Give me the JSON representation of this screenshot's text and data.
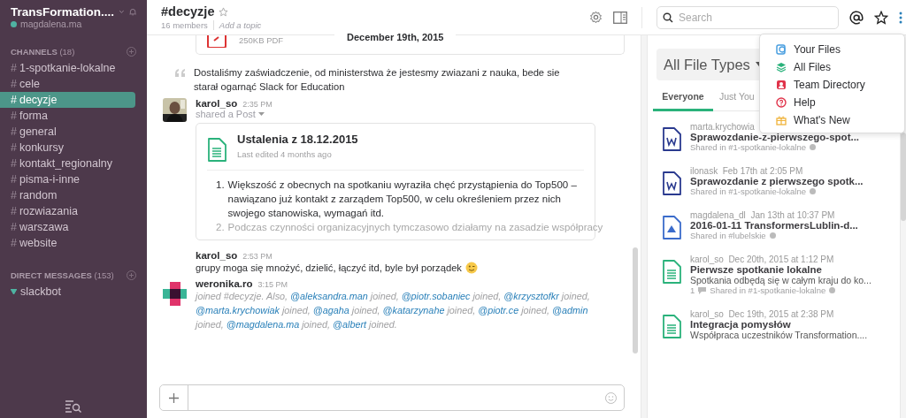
{
  "sidebar": {
    "team": "TransFormation....",
    "user": "magdalena.ma",
    "user_online": true,
    "channels_label": "CHANNELS",
    "channels_count": "(18)",
    "channels": [
      {
        "prefix": "#",
        "name": "1-spotkanie-lokalne",
        "selected": false
      },
      {
        "prefix": "#",
        "name": "cele",
        "selected": false
      },
      {
        "prefix": "#",
        "name": "decyzje",
        "selected": true
      },
      {
        "prefix": "#",
        "name": "forma",
        "selected": false
      },
      {
        "prefix": "#",
        "name": "general",
        "selected": false
      },
      {
        "prefix": "#",
        "name": "konkursy",
        "selected": false
      },
      {
        "prefix": "#",
        "name": "kontakt_regionalny",
        "selected": false
      },
      {
        "prefix": "#",
        "name": "pisma-i-inne",
        "selected": false
      },
      {
        "prefix": "#",
        "name": "random",
        "selected": false
      },
      {
        "prefix": "#",
        "name": "rozwiazania",
        "selected": false
      },
      {
        "prefix": "#",
        "name": "warszawa",
        "selected": false
      },
      {
        "prefix": "#",
        "name": "website",
        "selected": false
      }
    ],
    "dm_label": "DIRECT MESSAGES",
    "dm_count": "(153)",
    "direct_messages": [
      {
        "name": "slackbot",
        "online": true
      }
    ]
  },
  "header": {
    "channel": "#decyzje",
    "members": "16 members",
    "topic": "Add a topic",
    "search_placeholder": "Search"
  },
  "date_divider": "December 19th, 2015",
  "messages": [
    {
      "kind": "file_tail",
      "meta": "250KB PDF"
    },
    {
      "kind": "quote",
      "text": "Dostaliśmy zaświadczenie, od ministerstwa że jestesmy zwiazani z nauka, bede sie starał ogarnąć Slack for Education"
    },
    {
      "kind": "post",
      "author": "karol_so",
      "time": "2:35 PM",
      "action": "shared a Post",
      "title": "Ustalenia z 18.12.2015",
      "edited": "Last edited 4 months ago",
      "items": [
        {
          "marker": "1.",
          "text": "Większość z obecnych na spotkaniu wyraziła chęć przystąpienia do Top500 – nawiązano już kontakt z zarządem Top500, w celu określeniem przez nich swojego stanowiska, wymagań itd."
        },
        {
          "marker": "2.",
          "text": "Podczas czynności organizacyjnych tymczasowo działamy na zasadzie współpracy"
        }
      ]
    },
    {
      "kind": "message",
      "author": "karol_so",
      "time": "2:53 PM",
      "text": "grupy moga się mnożyć, dzielić, łączyć itd, byle był porządek"
    },
    {
      "kind": "join",
      "author": "weronika.ro",
      "time": "3:15 PM",
      "parts": [
        {
          "kind": "text",
          "text": "joined #decyzje. Also, "
        },
        {
          "kind": "mention",
          "text": "@aleksandra.man"
        },
        {
          "kind": "text",
          "text": " joined, "
        },
        {
          "kind": "mention",
          "text": "@piotr.sobaniec"
        },
        {
          "kind": "text",
          "text": " joined, "
        },
        {
          "kind": "mention",
          "text": "@krzysztofkr"
        },
        {
          "kind": "text",
          "text": " joined, "
        },
        {
          "kind": "mention",
          "text": "@marta.krychowiak"
        },
        {
          "kind": "text",
          "text": " joined, "
        },
        {
          "kind": "mention",
          "text": "@agaha"
        },
        {
          "kind": "text",
          "text": " joined, "
        },
        {
          "kind": "mention",
          "text": "@katarzynahe"
        },
        {
          "kind": "text",
          "text": " joined, "
        },
        {
          "kind": "mention",
          "text": "@piotr.ce"
        },
        {
          "kind": "text",
          "text": " joined, "
        },
        {
          "kind": "mention",
          "text": "@admin"
        },
        {
          "kind": "text",
          "text": " joined, "
        },
        {
          "kind": "mention",
          "text": "@magdalena.ma"
        },
        {
          "kind": "text",
          "text": " joined, "
        },
        {
          "kind": "mention",
          "text": "@albert"
        },
        {
          "kind": "text",
          "text": " joined."
        }
      ]
    }
  ],
  "files_panel": {
    "filter": "All File Types",
    "tabs": [
      {
        "label": "Everyone",
        "selected": true
      },
      {
        "label": "Just You",
        "selected": false
      }
    ],
    "files": [
      {
        "kind": "word",
        "author": "marta.krychowia",
        "title": "Sprawozdanie-z-pierwszego-spot...",
        "shared": "Shared in #1-spotkanie-lokalne"
      },
      {
        "kind": "word",
        "author": "ilonask",
        "time": "Feb 17th at 2:05 PM",
        "title": "Sprawozdanie z pierwszego spotk...",
        "shared": "Shared in #1-spotkanie-lokalne"
      },
      {
        "kind": "drive",
        "author": "magdalena_dl",
        "time": "Jan 13th at 10:37 PM",
        "title": "2016-01-11 TransformersLublin-d...",
        "shared": "Shared in #lubelskie"
      },
      {
        "kind": "post",
        "author": "karol_so",
        "time": "Dec 20th, 2015 at 1:12 PM",
        "title": "Pierwsze spotkanie lokalne",
        "preview": "Spotkania odbędą się w całym kraju do ko...",
        "comments": "1",
        "shared": "Shared in #1-spotkanie-lokalne"
      },
      {
        "kind": "post",
        "author": "karol_so",
        "time": "Dec 19th, 2015 at 2:38 PM",
        "title": "Integracja pomysłów",
        "preview": "Współpraca uczestników Transformation...."
      }
    ]
  },
  "menu": [
    {
      "kind": "your_files",
      "label": "Your Files"
    },
    {
      "kind": "all_files",
      "label": "All Files"
    },
    {
      "kind": "directory",
      "label": "Team Directory"
    },
    {
      "kind": "help",
      "label": "Help"
    },
    {
      "kind": "whats_new",
      "label": "What's New"
    }
  ]
}
